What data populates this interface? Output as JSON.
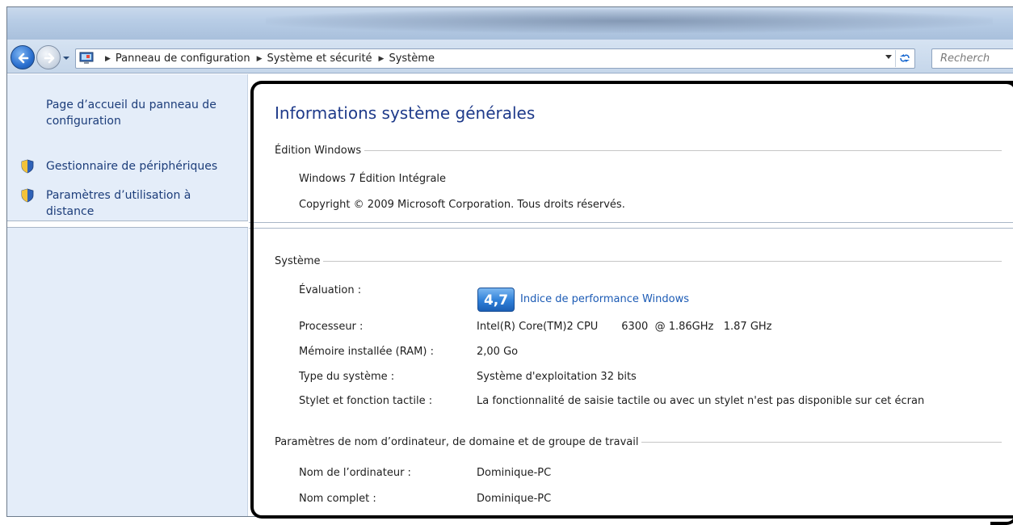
{
  "nav": {
    "breadcrumbs": [
      "Panneau de configuration",
      "Système et sécurité",
      "Système"
    ],
    "search_placeholder": "Recherch"
  },
  "sidebar": {
    "home_link": "Page d’accueil du panneau de configuration",
    "items": [
      {
        "label": "Gestionnaire de périphériques",
        "icon": "shield-icon"
      },
      {
        "label": "Paramètres d’utilisation à distance",
        "icon": "shield-icon"
      }
    ]
  },
  "main": {
    "title": "Informations système générales",
    "edition": {
      "heading": "Édition Windows",
      "name": "Windows 7 Édition Intégrale",
      "copyright": "Copyright © 2009 Microsoft Corporation. Tous droits réservés."
    },
    "system": {
      "heading": "Système",
      "rating_label": "Évaluation :",
      "rating_score": "4,7",
      "rating_link": "Indice de performance Windows",
      "rows": [
        {
          "label": "Processeur :",
          "value": "Intel(R) Core(TM)2 CPU       6300  @ 1.86GHz   1.87 GHz"
        },
        {
          "label": "Mémoire installée (RAM) :",
          "value": "2,00 Go"
        },
        {
          "label": "Type du système :",
          "value": "Système d'exploitation 32 bits"
        },
        {
          "label": "Stylet et fonction tactile :",
          "value": "La fonctionnalité de saisie tactile ou avec un stylet n'est pas disponible sur cet écran"
        }
      ]
    },
    "computer": {
      "heading": "Paramètres de nom d’ordinateur, de domaine et de groupe de travail",
      "rows": [
        {
          "label": "Nom de l’ordinateur :",
          "value": "Dominique-PC"
        },
        {
          "label": "Nom complet :",
          "value": "Dominique-PC"
        }
      ]
    }
  },
  "colors": {
    "accent_title": "#1e3a8a",
    "link": "#1c5bb5",
    "sidebar_bg": "#e4edf9",
    "highlight_frame": "#000000"
  }
}
